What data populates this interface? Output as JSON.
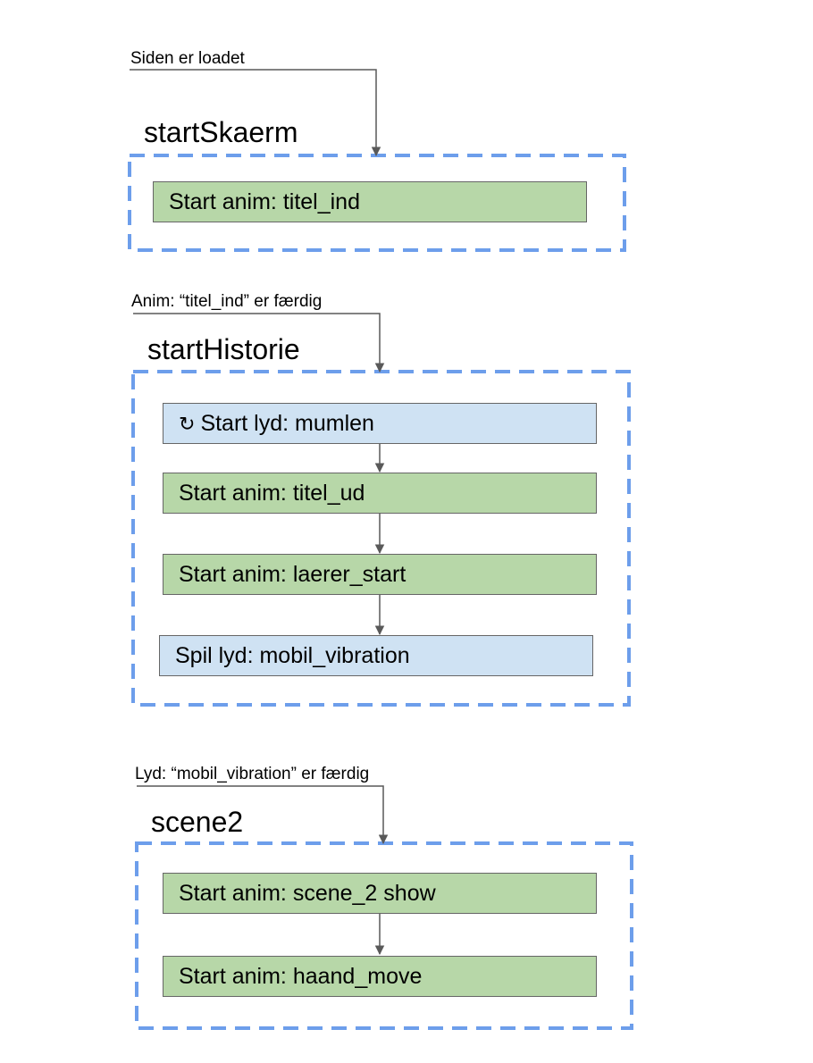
{
  "colors": {
    "anim_fill": "#b7d7a8",
    "sound_fill": "#cfe2f3",
    "group_border": "#6d9eeb",
    "connector": "#595959"
  },
  "sections": [
    {
      "trigger": "Siden er loadet",
      "title": "startSkaerm",
      "steps": [
        {
          "label": "Start anim: titel_ind",
          "kind": "anim"
        }
      ]
    },
    {
      "trigger": "Anim: “titel_ind” er færdig",
      "title": "startHistorie",
      "steps": [
        {
          "label": "Start lyd: mumlen",
          "kind": "sound",
          "icon": "loop-icon"
        },
        {
          "label": "Start anim: titel_ud",
          "kind": "anim"
        },
        {
          "label": "Start anim: laerer_start",
          "kind": "anim"
        },
        {
          "label": "Spil lyd: mobil_vibration",
          "kind": "sound"
        }
      ]
    },
    {
      "trigger": "Lyd: “mobil_vibration” er færdig",
      "title": "scene2",
      "steps": [
        {
          "label": "Start anim: scene_2 show",
          "kind": "anim"
        },
        {
          "label": "Start anim: haand_move",
          "kind": "anim"
        }
      ]
    }
  ]
}
